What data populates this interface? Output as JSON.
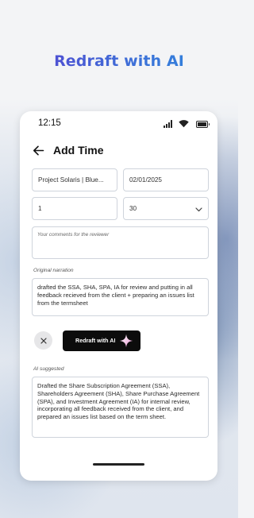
{
  "promo": {
    "headline": "Redraft with AI"
  },
  "status_bar": {
    "time": "12:15",
    "icons": [
      "signal-icon",
      "wifi-icon",
      "battery-icon"
    ]
  },
  "header": {
    "back_icon": "arrow-left-icon",
    "title": "Add Time"
  },
  "form": {
    "project": {
      "value": "Project Solaris | Blue..."
    },
    "date": {
      "value": "02/01/2025"
    },
    "hours": {
      "value": "1"
    },
    "minutes": {
      "value": "30",
      "icon": "chevron-down-icon"
    },
    "comments": {
      "placeholder": "Your comments for the reviewer",
      "value": ""
    }
  },
  "original_narration": {
    "label": "Original narration",
    "text": "drafted the SSA, SHA, SPA, IA for review and putting in all feedback recieved from the client + preparing an issues list from the termsheet"
  },
  "actions": {
    "close_icon": "close-icon",
    "redraft_label": "Redraft with AI",
    "redraft_icon": "sparkle-icon"
  },
  "ai_suggested": {
    "label": "AI suggested",
    "text": "Drafted the Share Subscription Agreement (SSA), Shareholders Agreement (SHA), Share Purchase Agreement (SPA), and Investment Agreement (IA) for internal review, incorporating all feedback received from the client, and prepared an issues list based on the term sheet."
  },
  "colors": {
    "headline_gradient": [
      "#5a3fd0",
      "#3a72d8",
      "#2c8ee0"
    ],
    "button_dark": "#0c0c0c",
    "sparkle_gradient": [
      "#ffffff",
      "#f2c6e6",
      "#d97dc4"
    ]
  }
}
